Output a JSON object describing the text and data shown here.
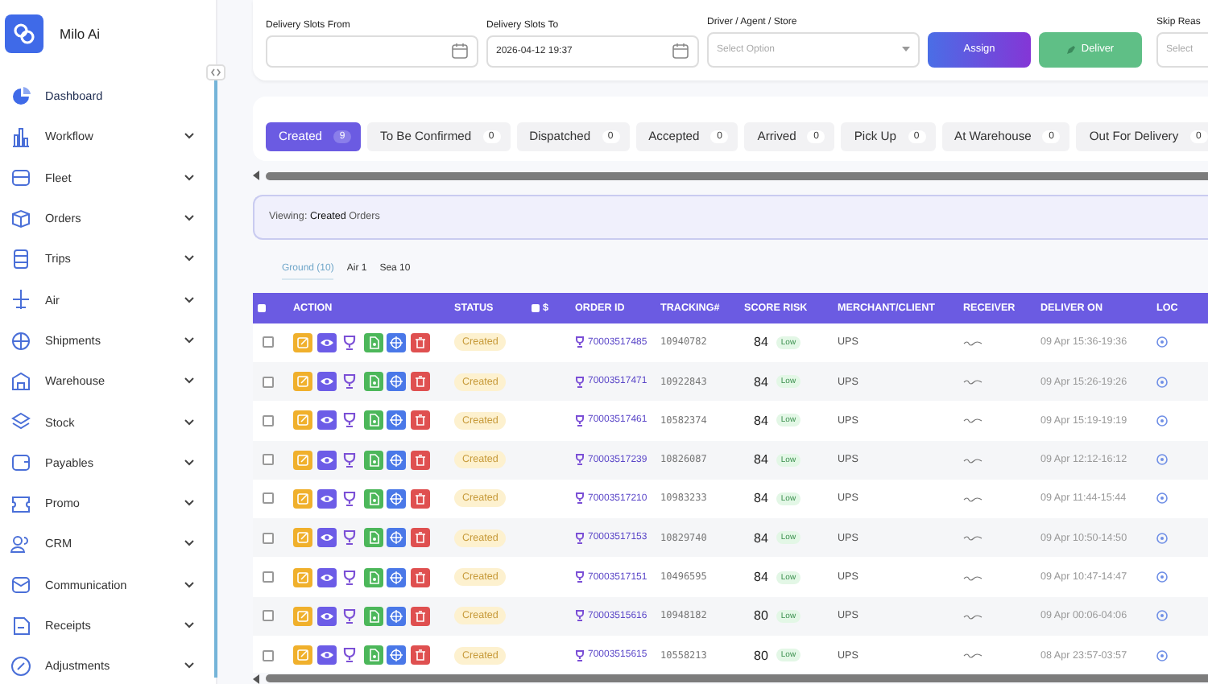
{
  "app": {
    "name": "Milo Ai"
  },
  "sidebar": {
    "items": [
      {
        "label": "Dashboard",
        "has_submenu": false,
        "selected": true
      },
      {
        "label": "Workflow",
        "has_submenu": true,
        "selected": false
      },
      {
        "label": "Fleet",
        "has_submenu": true,
        "selected": false
      },
      {
        "label": "Orders",
        "has_submenu": true,
        "selected": false
      },
      {
        "label": "Trips",
        "has_submenu": true,
        "selected": false
      },
      {
        "label": "Air",
        "has_submenu": true,
        "selected": false
      },
      {
        "label": "Shipments",
        "has_submenu": true,
        "selected": false
      },
      {
        "label": "Warehouse",
        "has_submenu": true,
        "selected": false
      },
      {
        "label": "Stock",
        "has_submenu": true,
        "selected": false
      },
      {
        "label": "Payables",
        "has_submenu": true,
        "selected": false
      },
      {
        "label": "Promo",
        "has_submenu": true,
        "selected": false
      },
      {
        "label": "CRM",
        "has_submenu": true,
        "selected": false
      },
      {
        "label": "Communication",
        "has_submenu": true,
        "selected": false
      },
      {
        "label": "Receipts",
        "has_submenu": true,
        "selected": false
      },
      {
        "label": "Adjustments",
        "has_submenu": true,
        "selected": false
      }
    ]
  },
  "filters": {
    "fields": [
      {
        "label": "Delivery Slots From",
        "kind": "date"
      },
      {
        "label": "Delivery Slots To",
        "kind": "date",
        "value": "2026-04-12 19:37"
      },
      {
        "label": "Driver / Agent / Store",
        "kind": "select",
        "placeholder": "Select Option"
      }
    ],
    "buttons": [
      {
        "label": "Assign",
        "kind": "assign"
      },
      {
        "label": "Deliver",
        "kind": "deliver"
      }
    ],
    "skip_field": {
      "label": "Skip Reas",
      "placeholder": "Select"
    }
  },
  "status_tabs": [
    {
      "label": "Created",
      "count": "9",
      "selected": true
    },
    {
      "label": "To Be Confirmed",
      "count": "0",
      "selected": false
    },
    {
      "label": "Dispatched",
      "count": "0",
      "selected": false
    },
    {
      "label": "Accepted",
      "count": "0",
      "selected": false
    },
    {
      "label": "Arrived",
      "count": "0",
      "selected": false
    },
    {
      "label": "Pick Up",
      "count": "0",
      "selected": false
    },
    {
      "label": "At Warehouse",
      "count": "0",
      "selected": false
    },
    {
      "label": "Out For Delivery",
      "count": "0",
      "selected": false
    }
  ],
  "viewing": "Viewing: **Created** Orders",
  "mode_tabs": [
    {
      "label": "Ground (10)",
      "selected": true
    },
    {
      "label": "Air 1",
      "selected": false
    },
    {
      "label": "Sea 10",
      "selected": false
    }
  ],
  "table": {
    "select_all_checked": false,
    "columns": [
      {
        "label": "ACTION",
        "kind": "text"
      },
      {
        "label": "STATUS",
        "kind": "text"
      },
      {
        "label": "$",
        "kind": "check",
        "checked": false
      },
      {
        "label": "ORDER ID",
        "kind": "text"
      },
      {
        "label": "TRACKING#",
        "kind": "text"
      },
      {
        "label": "SCORE RISK",
        "kind": "text"
      },
      {
        "label": "MERCHANT/CLIENT",
        "kind": "text"
      },
      {
        "label": "RECEIVER",
        "kind": "text"
      },
      {
        "label": "DELIVER ON",
        "kind": "text"
      },
      {
        "label": "LOC",
        "kind": "text"
      }
    ],
    "rows": [
      {
        "checked": false,
        "status": "Created",
        "order_id": "70003517485",
        "tracking": "10940782",
        "score": "84",
        "risk": "Low",
        "merchant": "UPS",
        "deliver_on": "09 Apr 15:36-19:36"
      },
      {
        "checked": false,
        "status": "Created",
        "order_id": "70003517471",
        "tracking": "10922843",
        "score": "84",
        "risk": "Low",
        "merchant": "UPS",
        "deliver_on": "09 Apr 15:26-19:26"
      },
      {
        "checked": false,
        "status": "Created",
        "order_id": "70003517461",
        "tracking": "10582374",
        "score": "84",
        "risk": "Low",
        "merchant": "UPS",
        "deliver_on": "09 Apr 15:19-19:19"
      },
      {
        "checked": false,
        "status": "Created",
        "order_id": "70003517239",
        "tracking": "10826087",
        "score": "84",
        "risk": "Low",
        "merchant": "UPS",
        "deliver_on": "09 Apr 12:12-16:12"
      },
      {
        "checked": false,
        "status": "Created",
        "order_id": "70003517210",
        "tracking": "10983233",
        "score": "84",
        "risk": "Low",
        "merchant": "UPS",
        "deliver_on": "09 Apr 11:44-15:44"
      },
      {
        "checked": false,
        "status": "Created",
        "order_id": "70003517153",
        "tracking": "10829740",
        "score": "84",
        "risk": "Low",
        "merchant": "UPS",
        "deliver_on": "09 Apr 10:50-14:50"
      },
      {
        "checked": false,
        "status": "Created",
        "order_id": "70003517151",
        "tracking": "10496595",
        "score": "84",
        "risk": "Low",
        "merchant": "UPS",
        "deliver_on": "09 Apr 10:47-14:47"
      },
      {
        "checked": false,
        "status": "Created",
        "order_id": "70003515616",
        "tracking": "10948182",
        "score": "80",
        "risk": "Low",
        "merchant": "UPS",
        "deliver_on": "09 Apr 00:06-04:06"
      },
      {
        "checked": false,
        "status": "Created",
        "order_id": "70003515615",
        "tracking": "10558213",
        "score": "80",
        "risk": "Low",
        "merchant": "UPS",
        "deliver_on": "08 Apr 23:57-03:57"
      }
    ]
  }
}
